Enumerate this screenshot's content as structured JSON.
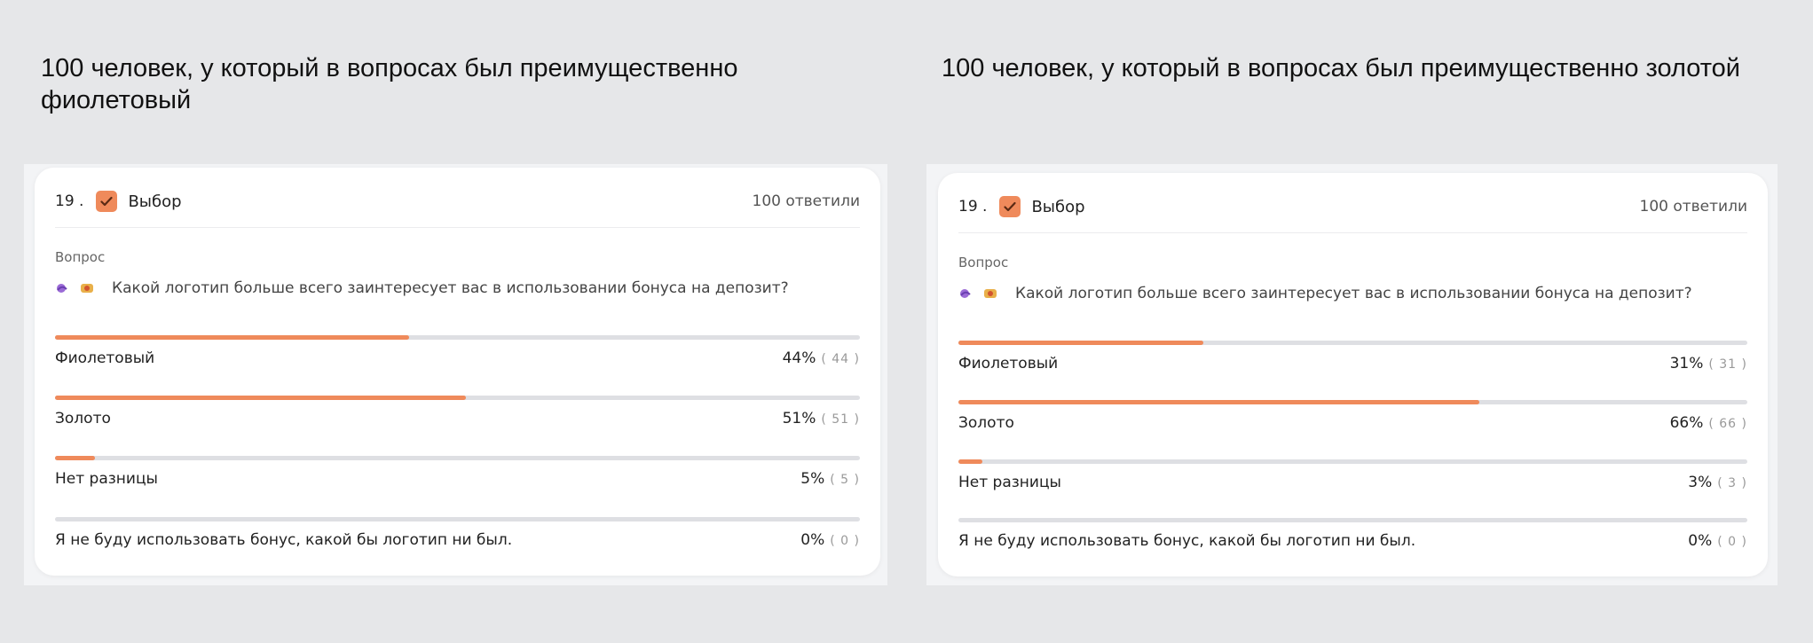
{
  "comparison": [
    {
      "heading": "100 человек, у который в вопросах был преимущественно фиолетовый",
      "card": {
        "number": "19 .",
        "type": "Выбор",
        "answers": "100 ответили",
        "question_label": "Вопрос",
        "question_text": "Какой логотип больше всего заинтересует вас в использовании бонуса на депозит?",
        "options": [
          {
            "label": "Фиолетовый",
            "percent": "44%",
            "count": "( 44 )",
            "fill_percent": 44
          },
          {
            "label": "Золото",
            "percent": "51%",
            "count": "( 51 )",
            "fill_percent": 51
          },
          {
            "label": "Нет разницы",
            "percent": "5%",
            "count": "( 5 )",
            "fill_percent": 5
          },
          {
            "label": "Я не буду использовать бонус, какой бы логотип ни был.",
            "percent": "0%",
            "count": "( 0 )",
            "fill_percent": 0
          }
        ]
      }
    },
    {
      "heading": "100 человек, у который в вопросах был преимущественно золотой",
      "card": {
        "number": "19 .",
        "type": "Выбор",
        "answers": "100 ответили",
        "question_label": "Вопрос",
        "question_text": "Какой логотип больше всего заинтересует вас в использовании бонуса на депозит?",
        "options": [
          {
            "label": "Фиолетовый",
            "percent": "31%",
            "count": "( 31 )",
            "fill_percent": 31
          },
          {
            "label": "Золото",
            "percent": "66%",
            "count": "( 66 )",
            "fill_percent": 66
          },
          {
            "label": "Нет разницы",
            "percent": "3%",
            "count": "( 3 )",
            "fill_percent": 3
          },
          {
            "label": "Я не буду использовать бонус, какой бы логотип ни был.",
            "percent": "0%",
            "count": "( 0 )",
            "fill_percent": 0
          }
        ]
      }
    }
  ],
  "colors": {
    "accent": "#ef8a5b",
    "track": "#dedfe3",
    "background": "#e6e7e9"
  },
  "icons": {
    "checkbox": "checkmark-icon",
    "emoji_1": "purple-logo-emoji-icon",
    "emoji_2": "gold-logo-emoji-icon"
  }
}
